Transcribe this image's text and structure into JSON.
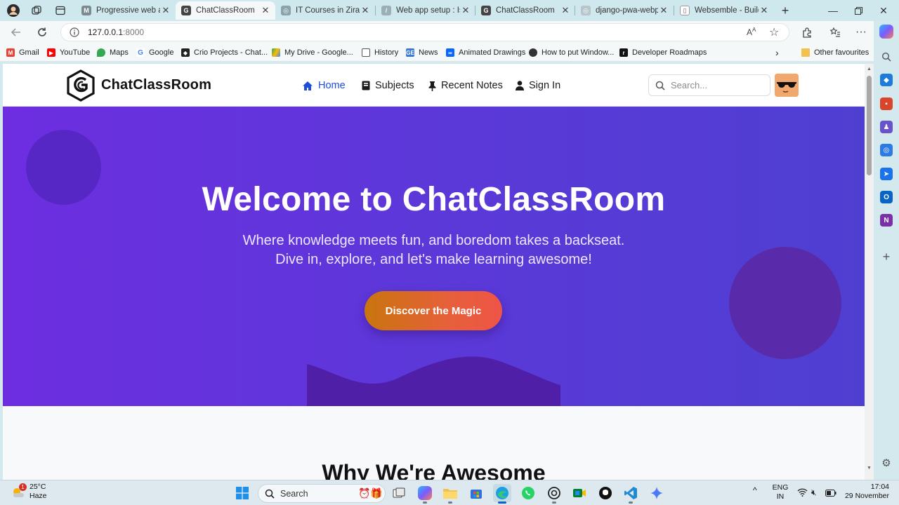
{
  "browser": {
    "tabs": [
      {
        "title": "Progressive web app",
        "icon": "m-icon"
      },
      {
        "title": "ChatClassRoom",
        "icon": "chatclassroom-icon",
        "active": true
      },
      {
        "title": "IT Courses in Zirakpu",
        "icon": "globe-icon"
      },
      {
        "title": "Web app setup : Isid",
        "icon": "feather-icon"
      },
      {
        "title": "ChatClassRoom",
        "icon": "chatclassroom-icon"
      },
      {
        "title": "django-pwa-webpus",
        "icon": "globe-icon"
      },
      {
        "title": "Websemble - Buildin",
        "icon": "document-icon"
      }
    ],
    "address": {
      "host": "127.0.0.1",
      "port": ":8000"
    },
    "bookmarks": [
      {
        "label": "Gmail",
        "icon": "gmail-icon",
        "color": "#ea4335"
      },
      {
        "label": "YouTube",
        "icon": "youtube-icon",
        "color": "#ff0000"
      },
      {
        "label": "Maps",
        "icon": "maps-icon",
        "color": "#34a853"
      },
      {
        "label": "Google",
        "icon": "google-icon",
        "color": "#4285f4"
      },
      {
        "label": "Crio Projects - Chat...",
        "icon": "crio-icon",
        "color": "#222222"
      },
      {
        "label": "My Drive - Google...",
        "icon": "drive-icon",
        "color": "#fbbc04"
      },
      {
        "label": "History",
        "icon": "document-icon",
        "color": "#555555"
      },
      {
        "label": "News",
        "icon": "news-icon",
        "color": "#3c79d9"
      },
      {
        "label": "Animated Drawings",
        "icon": "meta-icon",
        "color": "#0866ff"
      },
      {
        "label": "How to put Window...",
        "icon": "person-icon",
        "color": "#333333"
      },
      {
        "label": "Developer Roadmaps",
        "icon": "roadmap-icon",
        "color": "#111111"
      }
    ],
    "other_favourites": "Other favourites"
  },
  "site": {
    "brand": "ChatClassRoom",
    "nav": [
      {
        "label": "Home",
        "icon": "home-icon",
        "active": true
      },
      {
        "label": "Subjects",
        "icon": "book-icon"
      },
      {
        "label": "Recent Notes",
        "icon": "pin-icon"
      },
      {
        "label": "Sign In",
        "icon": "user-icon"
      }
    ],
    "search_placeholder": "Search...",
    "hero": {
      "title": "Welcome to ChatClassRoom",
      "subtitle_line1": "Where knowledge meets fun, and boredom takes a backseat.",
      "subtitle_line2": "Dive in, explore, and let's make learning awesome!",
      "cta": "Discover the Magic"
    },
    "section_title": "Why We're Awesome"
  },
  "taskbar": {
    "weather": {
      "temp": "25°C",
      "condition": "Haze",
      "badge": "1"
    },
    "search_label": "Search",
    "lang_line1": "ENG",
    "lang_line2": "IN",
    "time": "17:04",
    "date": "29 November"
  },
  "colors": {
    "hero_start": "#6d2ee0",
    "hero_end": "#4f3fd1",
    "nav_active": "#1d4ed8",
    "cta_start": "#c9750e",
    "cta_end": "#ee5548"
  }
}
